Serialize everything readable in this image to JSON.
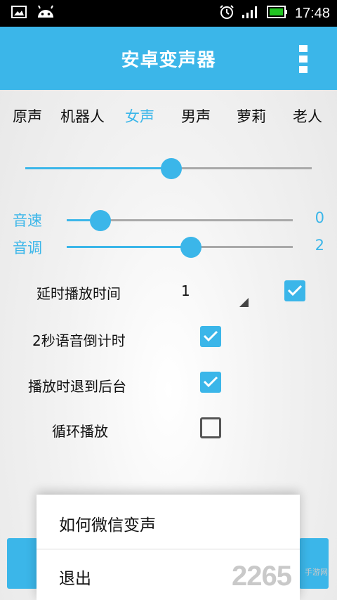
{
  "status_bar": {
    "time": "17:48",
    "colors": {
      "battery": "#22c422"
    }
  },
  "app_bar": {
    "title": "安卓变声器",
    "menu_icon": "overflow-menu-icon"
  },
  "voice_tabs": [
    {
      "label": "原声",
      "active": false
    },
    {
      "label": "机器人",
      "active": false
    },
    {
      "label": "女声",
      "active": true
    },
    {
      "label": "男声",
      "active": false
    },
    {
      "label": "萝莉",
      "active": false
    },
    {
      "label": "老人",
      "active": false
    }
  ],
  "main_slider": {
    "percent": 51
  },
  "speed": {
    "label": "音速",
    "value": "0",
    "percent": 15
  },
  "pitch": {
    "label": "音调",
    "value": "2",
    "percent": 55
  },
  "options": {
    "delay": {
      "label": "延时播放时间",
      "value": "1",
      "checked": true
    },
    "countdown": {
      "label": "2秒语音倒计时",
      "checked": true
    },
    "background": {
      "label": "播放时退到后台",
      "checked": true
    },
    "loop": {
      "label": "循环播放",
      "checked": false
    }
  },
  "popup_menu": {
    "items": [
      "如何微信变声",
      "退出"
    ]
  },
  "watermark": {
    "number": "2265",
    "sub": "手游网"
  },
  "colors": {
    "accent": "#3bb6e9",
    "text": "#111111"
  }
}
